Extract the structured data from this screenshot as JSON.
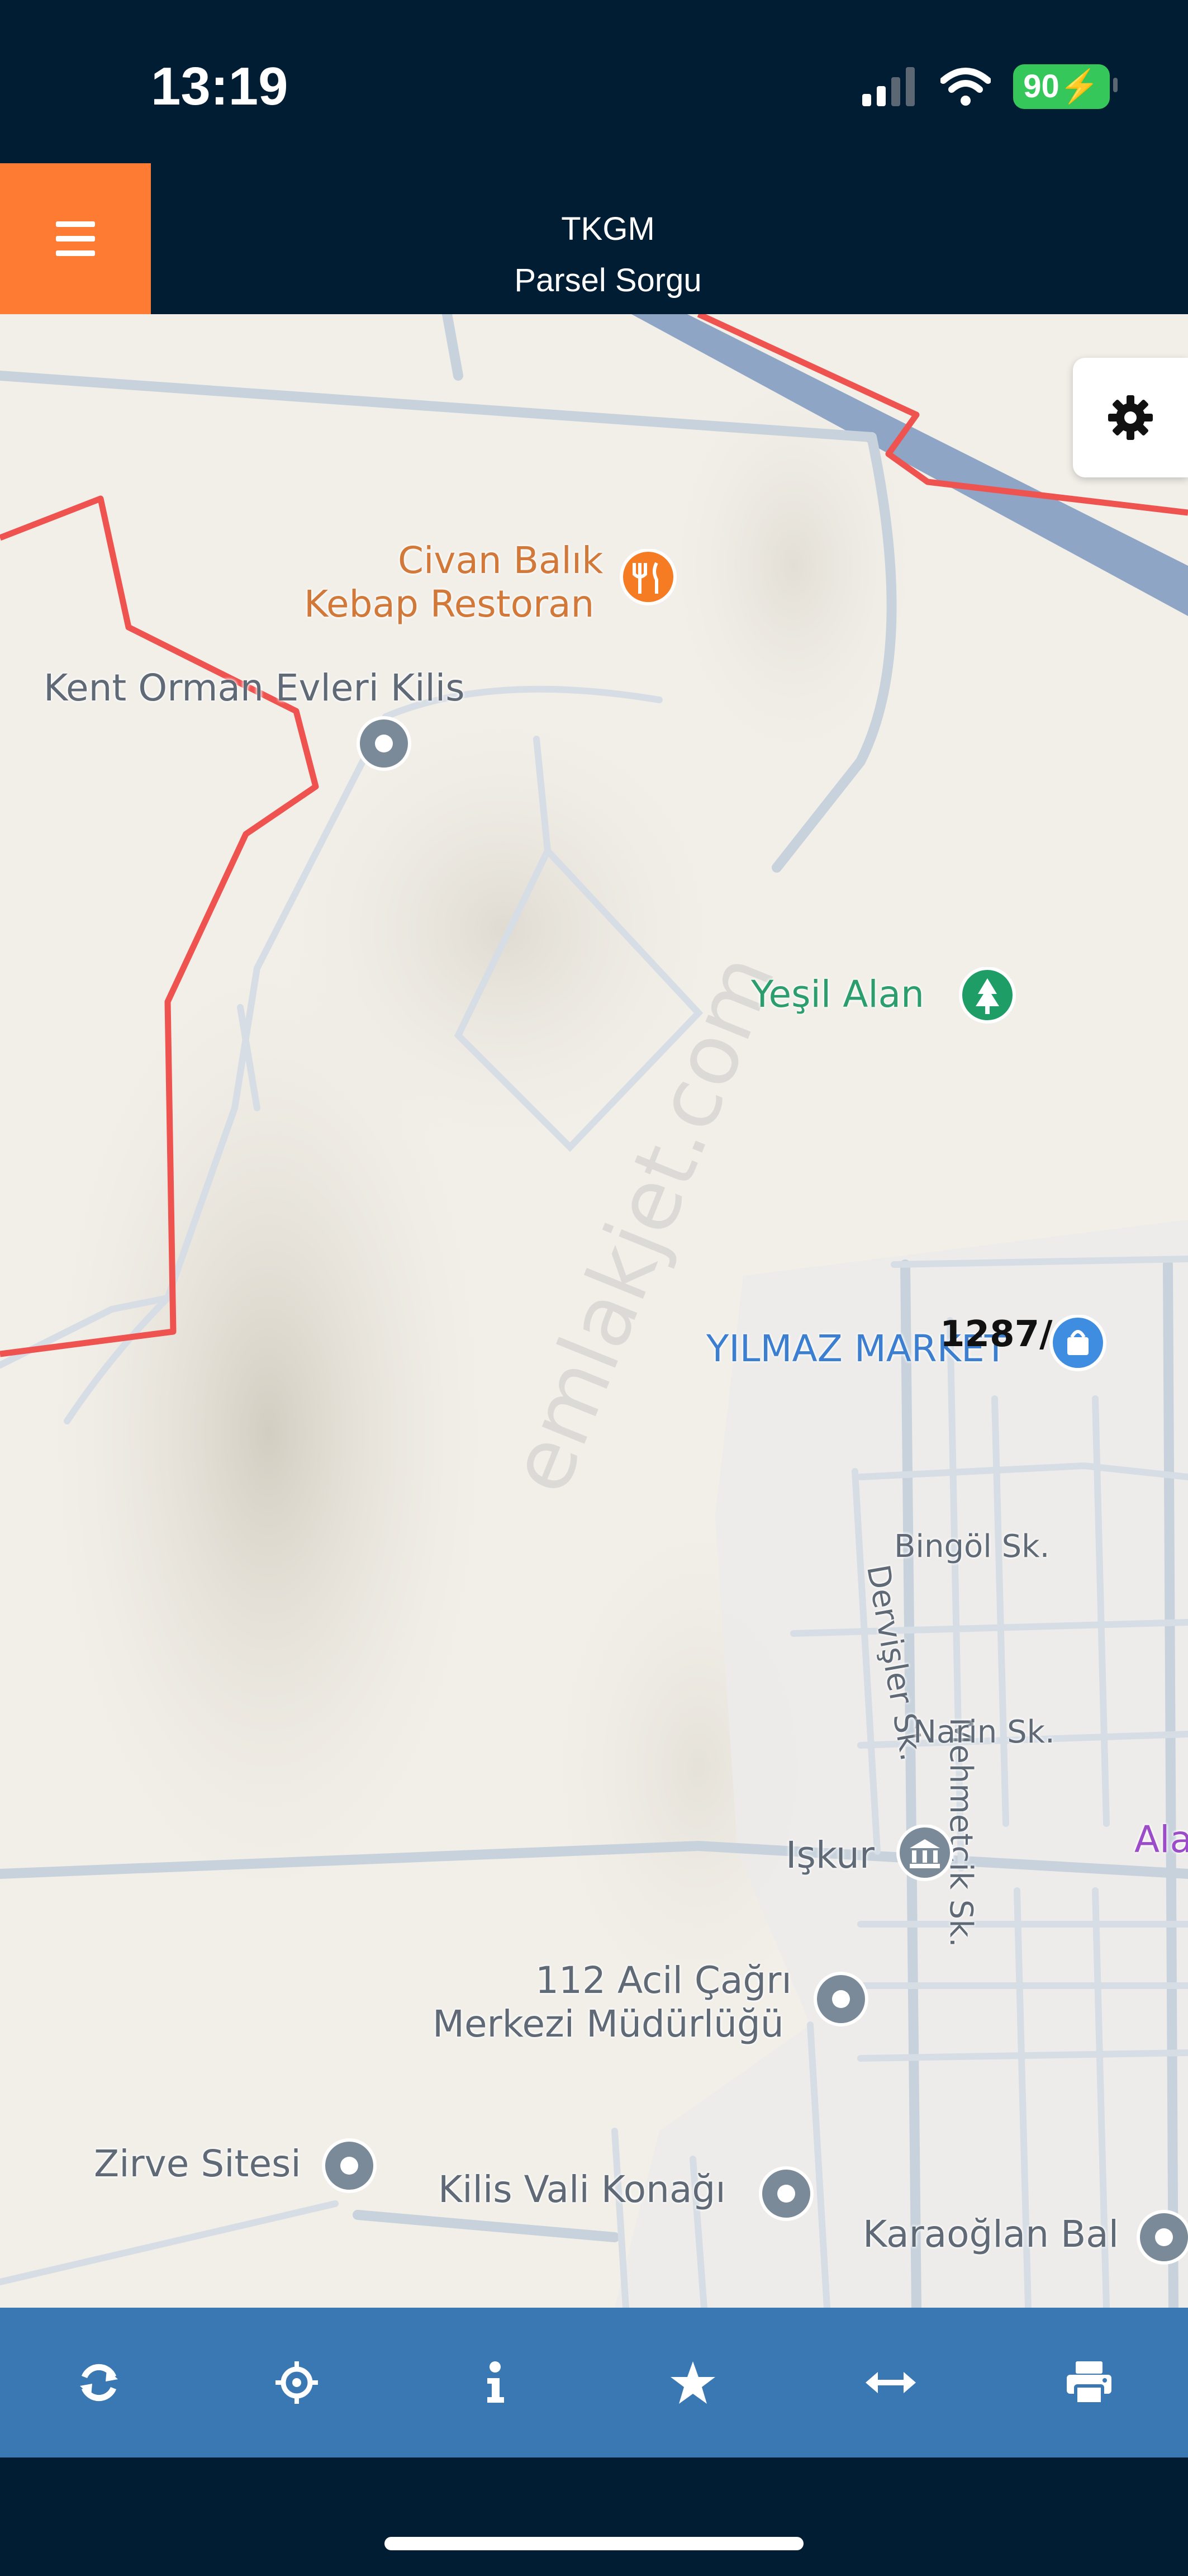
{
  "status": {
    "time": "13:19",
    "battery": "90"
  },
  "header": {
    "title_line1": "TKGM",
    "title_line2": "Parsel Sorgu"
  },
  "map": {
    "places": [
      {
        "text": "Civan Balık",
        "icon": "restaurant-icon"
      },
      {
        "text": "Kebap Restoran",
        "icon": "restaurant-icon"
      },
      {
        "text": "Kent Orman Evleri Kilis",
        "icon": "place-pin-icon"
      },
      {
        "text": "Yeşil Alan",
        "icon": "park-icon"
      },
      {
        "text": "YILMAZ MARKET",
        "icon": "shop-icon"
      },
      {
        "text": "Işkur",
        "icon": "government-icon"
      },
      {
        "text": "112 Acil Çağrı",
        "icon": "place-pin-icon"
      },
      {
        "text": "Merkezi Müdürlüğü",
        "icon": "place-pin-icon"
      },
      {
        "text": "Zirve Sitesi",
        "icon": "place-pin-icon"
      },
      {
        "text": "Kilis Vali Konağı",
        "icon": "place-pin-icon"
      },
      {
        "text": "Karaoğlan Bal",
        "icon": "place-pin-icon"
      },
      {
        "text": "Ala",
        "icon": ""
      }
    ],
    "streets": [
      "Bingöl Sk.",
      "Mehmetçik Sk.",
      "Dervişler Sk.",
      "Narin Sk."
    ],
    "parcel_label": "1287/4",
    "watermark": "emlakjet.com",
    "parcel_color": "#ef5350"
  },
  "toolbar": {
    "buttons": [
      {
        "icon": "refresh-icon"
      },
      {
        "icon": "locate-icon"
      },
      {
        "icon": "info-icon"
      },
      {
        "icon": "star-icon"
      },
      {
        "icon": "measure-icon"
      },
      {
        "icon": "print-icon"
      }
    ]
  },
  "colors": {
    "header_bg": "#011d33",
    "menu_accent": "#fd7b32",
    "toolbar_bg": "#3a78b4"
  }
}
